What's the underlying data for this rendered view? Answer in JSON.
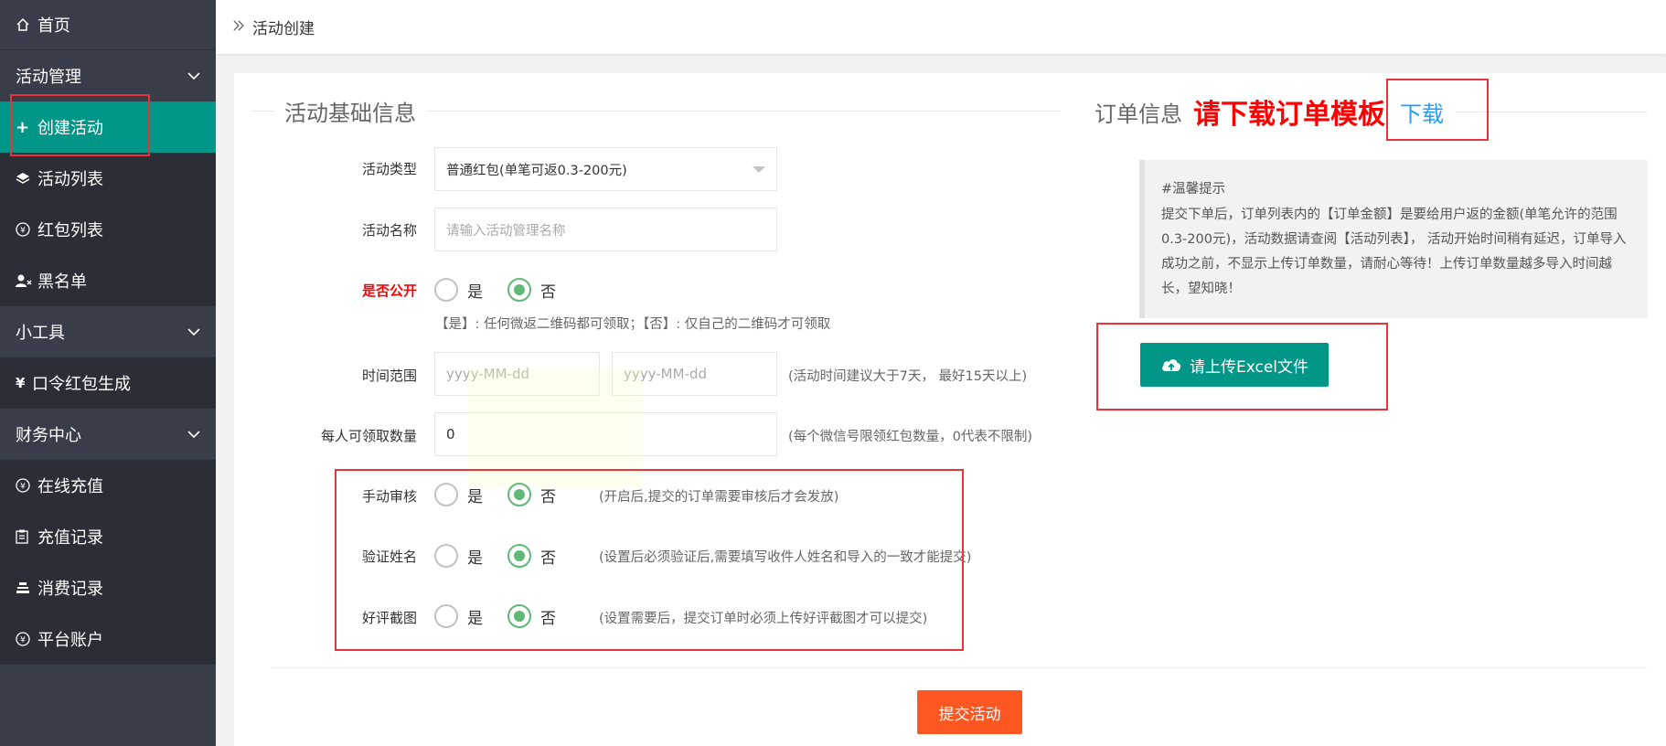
{
  "sidebar": {
    "home": "首页",
    "groups": [
      {
        "label": "活动管理",
        "items": [
          "创建活动",
          "活动列表",
          "红包列表",
          "黑名单"
        ]
      },
      {
        "label": "小工具",
        "items": [
          "口令红包生成"
        ]
      },
      {
        "label": "财务中心",
        "items": [
          "在线充值",
          "充值记录",
          "消费记录",
          "平台账户"
        ]
      }
    ]
  },
  "breadcrumb": "活动创建",
  "basic_section": {
    "title": "活动基础信息",
    "type_label": "活动类型",
    "type_value": "普通红包(单笔可返0.3-200元)",
    "name_label": "活动名称",
    "name_placeholder": "请输入活动管理名称",
    "public_label": "是否公开",
    "yes": "是",
    "no": "否",
    "public_hint": "【是】: 任何微返二维码都可领取；【否】: 仅自己的二维码才可领取",
    "time_label": "时间范围",
    "date_placeholder": "yyyy-MM-dd",
    "time_hint": "(活动时间建议大于7天， 最好15天以上)",
    "quota_label": "每人可领取数量",
    "quota_value": "0",
    "quota_hint": "(每个微信号限领红包数量，0代表不限制)",
    "manual_label": "手动审核",
    "manual_hint": "(开启后,提交的订单需要审核后才会发放)",
    "verify_label": "验证姓名",
    "verify_hint": "(设置后必须验证后,需要填写收件人姓名和导入的一致才能提交)",
    "review_label": "好评截图",
    "review_hint": "(设置需要后，提交订单时必须上传好评截图才可以提交)",
    "submit": "提交活动"
  },
  "order_section": {
    "title": "订单信息",
    "emphasis": "请下载订单模板",
    "download": "下载",
    "tips_title": "#温馨提示",
    "tips_body": "提交下单后，订单列表内的【订单金额】是要给用户返的金额(单笔允许的范围0.3-200元)，活动数据请查阅【活动列表】， 活动开始时间稍有延迟，订单导入成功之前，不显示上传订单数量，请耐心等待！上传订单数量越多导入时间越长，望知晓！",
    "upload": "请上传Excel文件"
  },
  "colors": {
    "sidebar_bg": "#393d49",
    "active": "#009688",
    "submit": "#FF5722",
    "annotation": "#e8333a"
  }
}
